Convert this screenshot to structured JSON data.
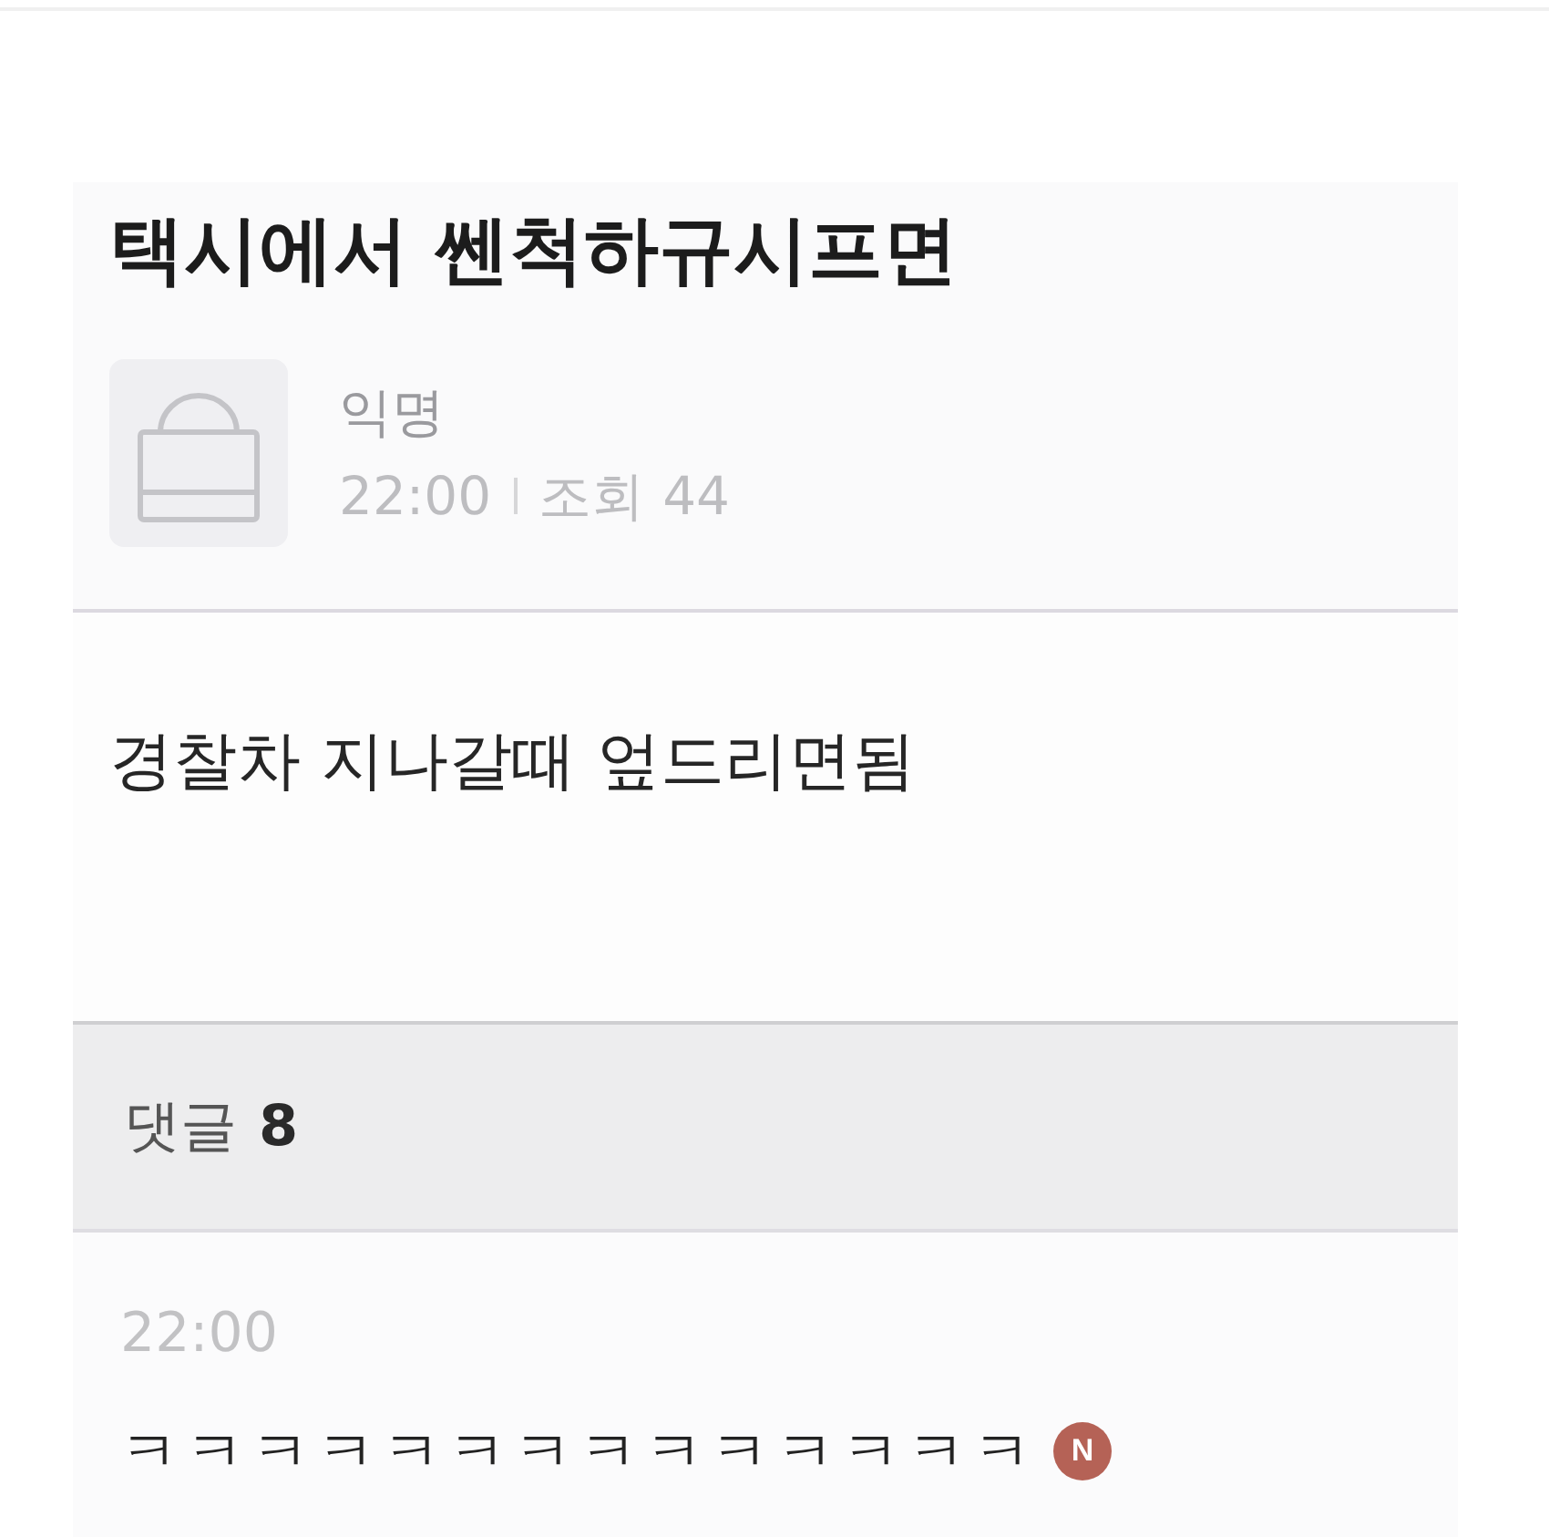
{
  "post": {
    "title": "택시에서 쎈척하규시프면",
    "author": {
      "name": "익명",
      "time": "22:00",
      "views_label": "조회",
      "views": "44"
    },
    "body": "경찰차 지나갈때 엎드리면됨"
  },
  "comments": {
    "label": "댓글",
    "count": "8",
    "items": [
      {
        "time": "22:00",
        "text": "ㅋㅋㅋㅋㅋㅋㅋㅋㅋㅋㅋㅋㅋㅋ",
        "new": true,
        "badge": "N"
      }
    ]
  }
}
